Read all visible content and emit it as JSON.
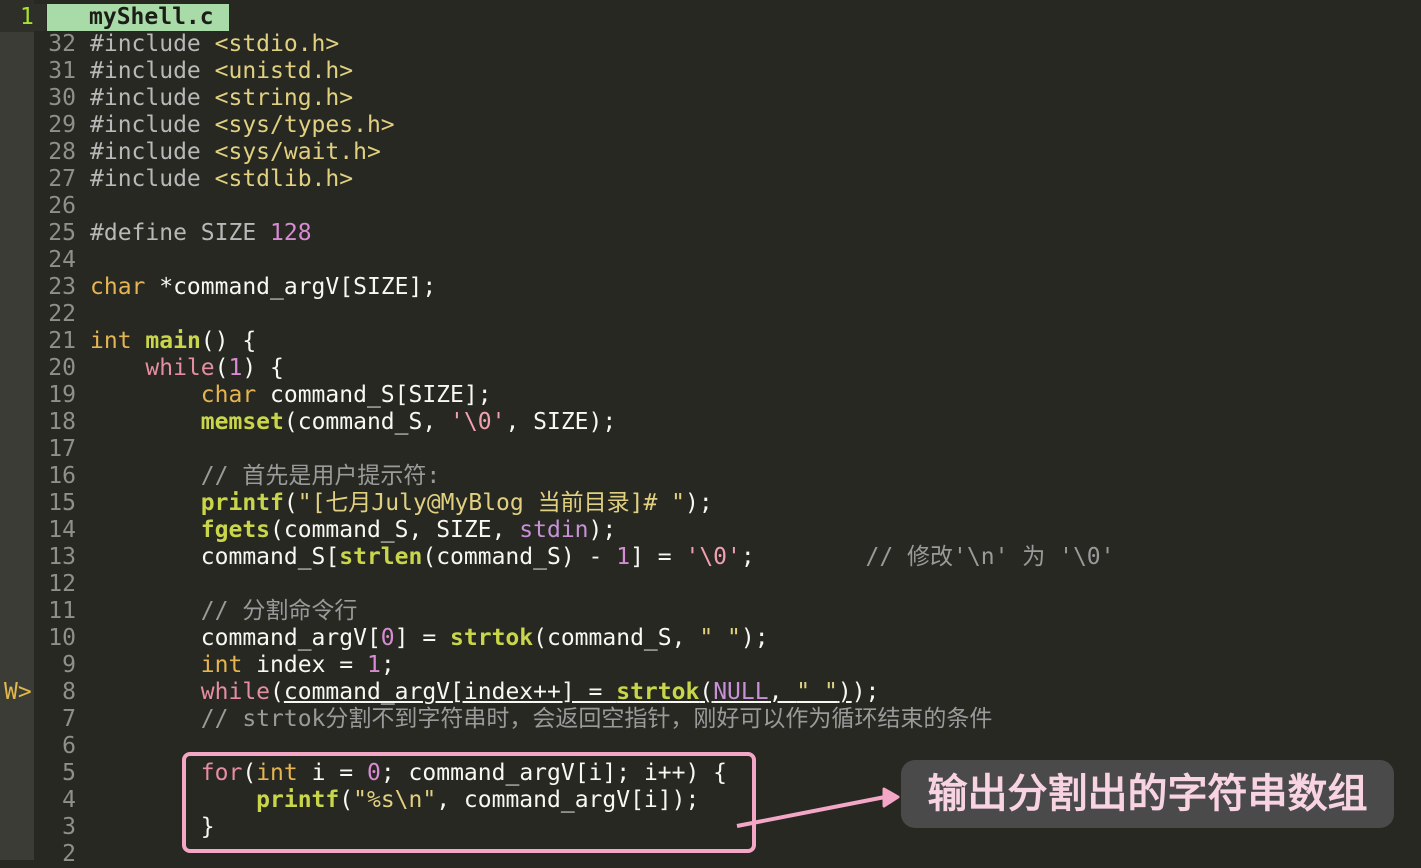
{
  "tab": {
    "number": "1",
    "filename": "myShell.c"
  },
  "sign_marker": "W>",
  "lines": [
    {
      "num": "32",
      "segs": [
        {
          "t": "#include ",
          "c": "pre"
        },
        {
          "t": "<stdio.h>",
          "c": "str"
        }
      ]
    },
    {
      "num": "31",
      "segs": [
        {
          "t": "#include ",
          "c": "pre"
        },
        {
          "t": "<unistd.h>",
          "c": "str"
        }
      ]
    },
    {
      "num": "30",
      "segs": [
        {
          "t": "#include ",
          "c": "pre"
        },
        {
          "t": "<string.h>",
          "c": "str"
        }
      ]
    },
    {
      "num": "29",
      "segs": [
        {
          "t": "#include ",
          "c": "pre"
        },
        {
          "t": "<sys/types.h>",
          "c": "str"
        }
      ]
    },
    {
      "num": "28",
      "segs": [
        {
          "t": "#include ",
          "c": "pre"
        },
        {
          "t": "<sys/wait.h>",
          "c": "str"
        }
      ]
    },
    {
      "num": "27",
      "segs": [
        {
          "t": "#include ",
          "c": "pre"
        },
        {
          "t": "<stdlib.h>",
          "c": "str"
        }
      ]
    },
    {
      "num": "26",
      "segs": []
    },
    {
      "num": "25",
      "segs": [
        {
          "t": "#define SIZE ",
          "c": "pre"
        },
        {
          "t": "128",
          "c": "num"
        }
      ]
    },
    {
      "num": "24",
      "segs": []
    },
    {
      "num": "23",
      "segs": [
        {
          "t": "char",
          "c": "ty"
        },
        {
          "t": " *command_argV[SIZE];",
          "c": ""
        }
      ]
    },
    {
      "num": "22",
      "segs": []
    },
    {
      "num": "21",
      "segs": [
        {
          "t": "int",
          "c": "ty"
        },
        {
          "t": " ",
          "c": ""
        },
        {
          "t": "main",
          "c": "fn"
        },
        {
          "t": "() {",
          "c": ""
        }
      ]
    },
    {
      "num": "20",
      "segs": [
        {
          "t": "    ",
          "c": ""
        },
        {
          "t": "while",
          "c": "kw2"
        },
        {
          "t": "(",
          "c": ""
        },
        {
          "t": "1",
          "c": "num"
        },
        {
          "t": ") {",
          "c": ""
        }
      ]
    },
    {
      "num": "19",
      "segs": [
        {
          "t": "        ",
          "c": ""
        },
        {
          "t": "char",
          "c": "ty"
        },
        {
          "t": " command_S[SIZE];",
          "c": ""
        }
      ]
    },
    {
      "num": "18",
      "segs": [
        {
          "t": "        ",
          "c": ""
        },
        {
          "t": "memset",
          "c": "fn"
        },
        {
          "t": "(command_S, ",
          "c": ""
        },
        {
          "t": "'\\0'",
          "c": "strc"
        },
        {
          "t": ", SIZE);",
          "c": ""
        }
      ]
    },
    {
      "num": "17",
      "segs": []
    },
    {
      "num": "16",
      "segs": [
        {
          "t": "        // 首先是用户提示符:",
          "c": "cm"
        }
      ]
    },
    {
      "num": "15",
      "segs": [
        {
          "t": "        ",
          "c": ""
        },
        {
          "t": "printf",
          "c": "fn"
        },
        {
          "t": "(",
          "c": ""
        },
        {
          "t": "\"[七月July@MyBlog 当前目录]# \"",
          "c": "str"
        },
        {
          "t": ");",
          "c": ""
        }
      ]
    },
    {
      "num": "14",
      "segs": [
        {
          "t": "        ",
          "c": ""
        },
        {
          "t": "fgets",
          "c": "fn"
        },
        {
          "t": "(command_S, SIZE, ",
          "c": ""
        },
        {
          "t": "stdin",
          "c": "kwnull"
        },
        {
          "t": ");",
          "c": ""
        }
      ]
    },
    {
      "num": "13",
      "segs": [
        {
          "t": "        command_S[",
          "c": ""
        },
        {
          "t": "strlen",
          "c": "fn"
        },
        {
          "t": "(command_S) - ",
          "c": ""
        },
        {
          "t": "1",
          "c": "num"
        },
        {
          "t": "] = ",
          "c": ""
        },
        {
          "t": "'\\0'",
          "c": "strc"
        },
        {
          "t": ";        ",
          "c": ""
        },
        {
          "t": "// 修改'\\n' 为 '\\0'",
          "c": "cm"
        }
      ]
    },
    {
      "num": "12",
      "segs": []
    },
    {
      "num": "11",
      "segs": [
        {
          "t": "        // 分割命令行",
          "c": "cm"
        }
      ]
    },
    {
      "num": "10",
      "segs": [
        {
          "t": "        command_argV[",
          "c": ""
        },
        {
          "t": "0",
          "c": "num"
        },
        {
          "t": "] = ",
          "c": ""
        },
        {
          "t": "strtok",
          "c": "fn"
        },
        {
          "t": "(command_S, ",
          "c": ""
        },
        {
          "t": "\" \"",
          "c": "str"
        },
        {
          "t": ");",
          "c": ""
        }
      ]
    },
    {
      "num": "9",
      "segs": [
        {
          "t": "        ",
          "c": ""
        },
        {
          "t": "int",
          "c": "ty"
        },
        {
          "t": " index = ",
          "c": ""
        },
        {
          "t": "1",
          "c": "num"
        },
        {
          "t": ";",
          "c": ""
        }
      ]
    },
    {
      "num": "8",
      "sign": true,
      "segs": [
        {
          "t": "        ",
          "c": ""
        },
        {
          "t": "while",
          "c": "kw2"
        },
        {
          "t": "(",
          "c": ""
        },
        {
          "t": "command_argV[index++] = ",
          "c": "u"
        },
        {
          "t": "strtok",
          "c": "fn u"
        },
        {
          "t": "(",
          "c": "u"
        },
        {
          "t": "NULL",
          "c": "kwnull u"
        },
        {
          "t": ", ",
          "c": "u"
        },
        {
          "t": "\" \"",
          "c": "str u"
        },
        {
          "t": ")",
          "c": "u"
        },
        {
          "t": ");",
          "c": ""
        }
      ]
    },
    {
      "num": "7",
      "segs": [
        {
          "t": "        // strtok分割不到字符串时，会返回空指针，刚好可以作为循环结束的条件",
          "c": "cm"
        }
      ]
    },
    {
      "num": "6",
      "segs": []
    },
    {
      "num": "5",
      "segs": [
        {
          "t": "        ",
          "c": ""
        },
        {
          "t": "for",
          "c": "kw2"
        },
        {
          "t": "(",
          "c": ""
        },
        {
          "t": "int",
          "c": "ty"
        },
        {
          "t": " i = ",
          "c": ""
        },
        {
          "t": "0",
          "c": "num"
        },
        {
          "t": "; command_argV[i]; i++) {",
          "c": ""
        }
      ]
    },
    {
      "num": "4",
      "segs": [
        {
          "t": "            ",
          "c": ""
        },
        {
          "t": "printf",
          "c": "fn"
        },
        {
          "t": "(",
          "c": ""
        },
        {
          "t": "\"%s\\n\"",
          "c": "str"
        },
        {
          "t": ", command_argV[i]);",
          "c": ""
        }
      ]
    },
    {
      "num": "3",
      "segs": [
        {
          "t": "        }",
          "c": ""
        }
      ]
    },
    {
      "num": "2",
      "segs": []
    }
  ],
  "annotation": {
    "label": "输出分割出的字符串数组"
  },
  "colors": {
    "box_border": "#f4a6c6",
    "callout_bg": "#4a4a4a",
    "tab_bg": "#a8dba8"
  }
}
